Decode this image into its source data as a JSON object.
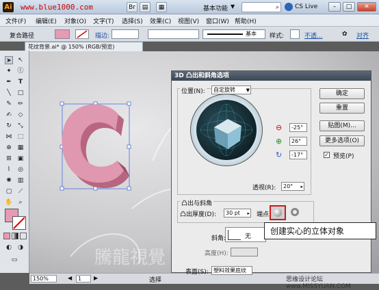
{
  "watermark_url": "www.blue1000.com",
  "titlebar": {
    "logo": "Ai",
    "workspace": "基本功能",
    "cs_live": "CS Live",
    "search_placeholder": ""
  },
  "menu": [
    "文件(F)",
    "编辑(E)",
    "对象(O)",
    "文字(T)",
    "选择(S)",
    "效果(C)",
    "视图(V)",
    "窗口(W)",
    "帮助(H)"
  ],
  "controlbar": {
    "path_label": "复合路径",
    "stroke_label": "描边:",
    "stroke_style": "基本",
    "style_label": "样式:",
    "opacity_label": "不透...",
    "more_label": "对齐"
  },
  "document_tab": "花纹背景.ai* @ 150% (RGB/预览)",
  "status": {
    "zoom": "150%",
    "page": "1",
    "tool": "选择"
  },
  "dialog": {
    "title": "3D 凸出和斜角选项",
    "position_label": "位置(N):",
    "position_value": "自定旋转",
    "angle_x": "-25°",
    "angle_y": "26°",
    "angle_z": "-17°",
    "perspective_label": "透视(R):",
    "perspective_value": "20°",
    "extrude_group": "凸出与斜角",
    "extrude_depth_label": "凸出厚度(D):",
    "extrude_depth_value": "30 pt",
    "cap_label": "端点:",
    "bevel_label": "斜角:",
    "bevel_value": "无",
    "height_label": "高度(H):",
    "surface_label": "表面(S):",
    "surface_value": "塑料效果底纹",
    "buttons": {
      "ok": "确定",
      "reset": "重置",
      "map": "贴图(M)...",
      "more_options": "更多选项(O)",
      "preview": "预览(P)"
    }
  },
  "callout_text": "创建实心的立体对象",
  "watermarks": {
    "bottom_right": "思缘设计论坛  www.MISSYUAN.COM",
    "center": "騰龍視覺"
  },
  "colors": {
    "pink_shape": "#d98aa4",
    "highlight_box": "#cc1a1a",
    "dialog_title": "#3c4654"
  }
}
